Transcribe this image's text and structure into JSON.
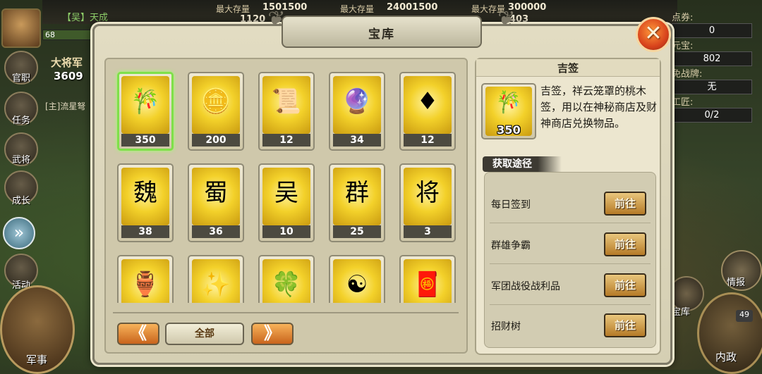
{
  "background": {
    "player_name": "【吴】天成",
    "level": "68",
    "power_label": "大将军",
    "power_value": "3609",
    "chat_line": "[主]流星弩",
    "top_stats": [
      {
        "label": "最大存量",
        "value": "1501500",
        "over": "1120"
      },
      {
        "label": "最大存量",
        "value": "24001500",
        "over": ""
      },
      {
        "label": "最大存量",
        "value": "300000",
        "over": "403"
      }
    ],
    "left_menu": [
      "官职",
      "任务",
      "武将",
      "成长",
      "活动"
    ],
    "military_label": "军事",
    "right_stats": [
      {
        "label": "点券:",
        "value": "0"
      },
      {
        "label": "元宝:",
        "value": "802"
      },
      {
        "label": "免战牌:",
        "value": "无"
      },
      {
        "label": "工匠:",
        "value": "0/2"
      }
    ],
    "intel_label": "情报",
    "treasury_label": "宝库",
    "affairs_label": "内政",
    "affairs_badge": "49"
  },
  "dialog": {
    "title": "宝库",
    "close_icon": "close-x",
    "items": [
      {
        "name": "吉签",
        "icon": "bamboo-slip",
        "glyph": "🎋",
        "count": "350",
        "selected": true
      },
      {
        "name": "金条",
        "icon": "gold-bars",
        "glyph": "🪙",
        "count": "200",
        "selected": false
      },
      {
        "name": "卷轴",
        "icon": "scroll",
        "glyph": "📜",
        "count": "12",
        "selected": false
      },
      {
        "name": "紫宝石",
        "icon": "purple-gem",
        "glyph": "🔮",
        "count": "34",
        "selected": false
      },
      {
        "name": "红宝石",
        "icon": "red-gem",
        "glyph": "♦",
        "count": "12",
        "selected": false
      },
      {
        "name": "魏",
        "icon": "wei-orb",
        "glyph": "魏",
        "count": "38",
        "selected": false
      },
      {
        "name": "蜀",
        "icon": "shu-orb",
        "glyph": "蜀",
        "count": "36",
        "selected": false
      },
      {
        "name": "吴",
        "icon": "wu-orb",
        "glyph": "吴",
        "count": "10",
        "selected": false
      },
      {
        "name": "群",
        "icon": "qun-orb",
        "glyph": "群",
        "count": "25",
        "selected": false
      },
      {
        "name": "将",
        "icon": "general-token",
        "glyph": "将",
        "count": "3",
        "selected": false
      },
      {
        "name": "鼎",
        "icon": "cauldron",
        "glyph": "🏺",
        "count": "",
        "selected": false
      },
      {
        "name": "粉末",
        "icon": "powder",
        "glyph": "✨",
        "count": "",
        "selected": false
      },
      {
        "name": "玉",
        "icon": "jade",
        "glyph": "🍀",
        "count": "",
        "selected": false
      },
      {
        "name": "太极",
        "icon": "yin-yang",
        "glyph": "☯",
        "count": "",
        "selected": false
      },
      {
        "name": "红锦囊",
        "icon": "red-bag",
        "glyph": "🧧",
        "count": "",
        "selected": false
      }
    ],
    "prev_glyph": "《",
    "next_glyph": "》",
    "filter_label": "全部"
  },
  "detail": {
    "title": "吉签",
    "icon_glyph": "🎋",
    "count": "350",
    "description": "吉签，祥云笼罩的桃木签，用以在神秘商店及财神商店兑换物品。",
    "source_heading": "获取途径",
    "sources": [
      {
        "label": "每日签到",
        "button": "前往"
      },
      {
        "label": "群雄争霸",
        "button": "前往"
      },
      {
        "label": "军团战役战利品",
        "button": "前往"
      },
      {
        "label": "招财树",
        "button": "前往"
      }
    ]
  },
  "colors": {
    "selected_border": "#7fe04a",
    "item_gold": "#f3d12a",
    "close_button": "#e8571f",
    "go_button": "#c9913a"
  }
}
